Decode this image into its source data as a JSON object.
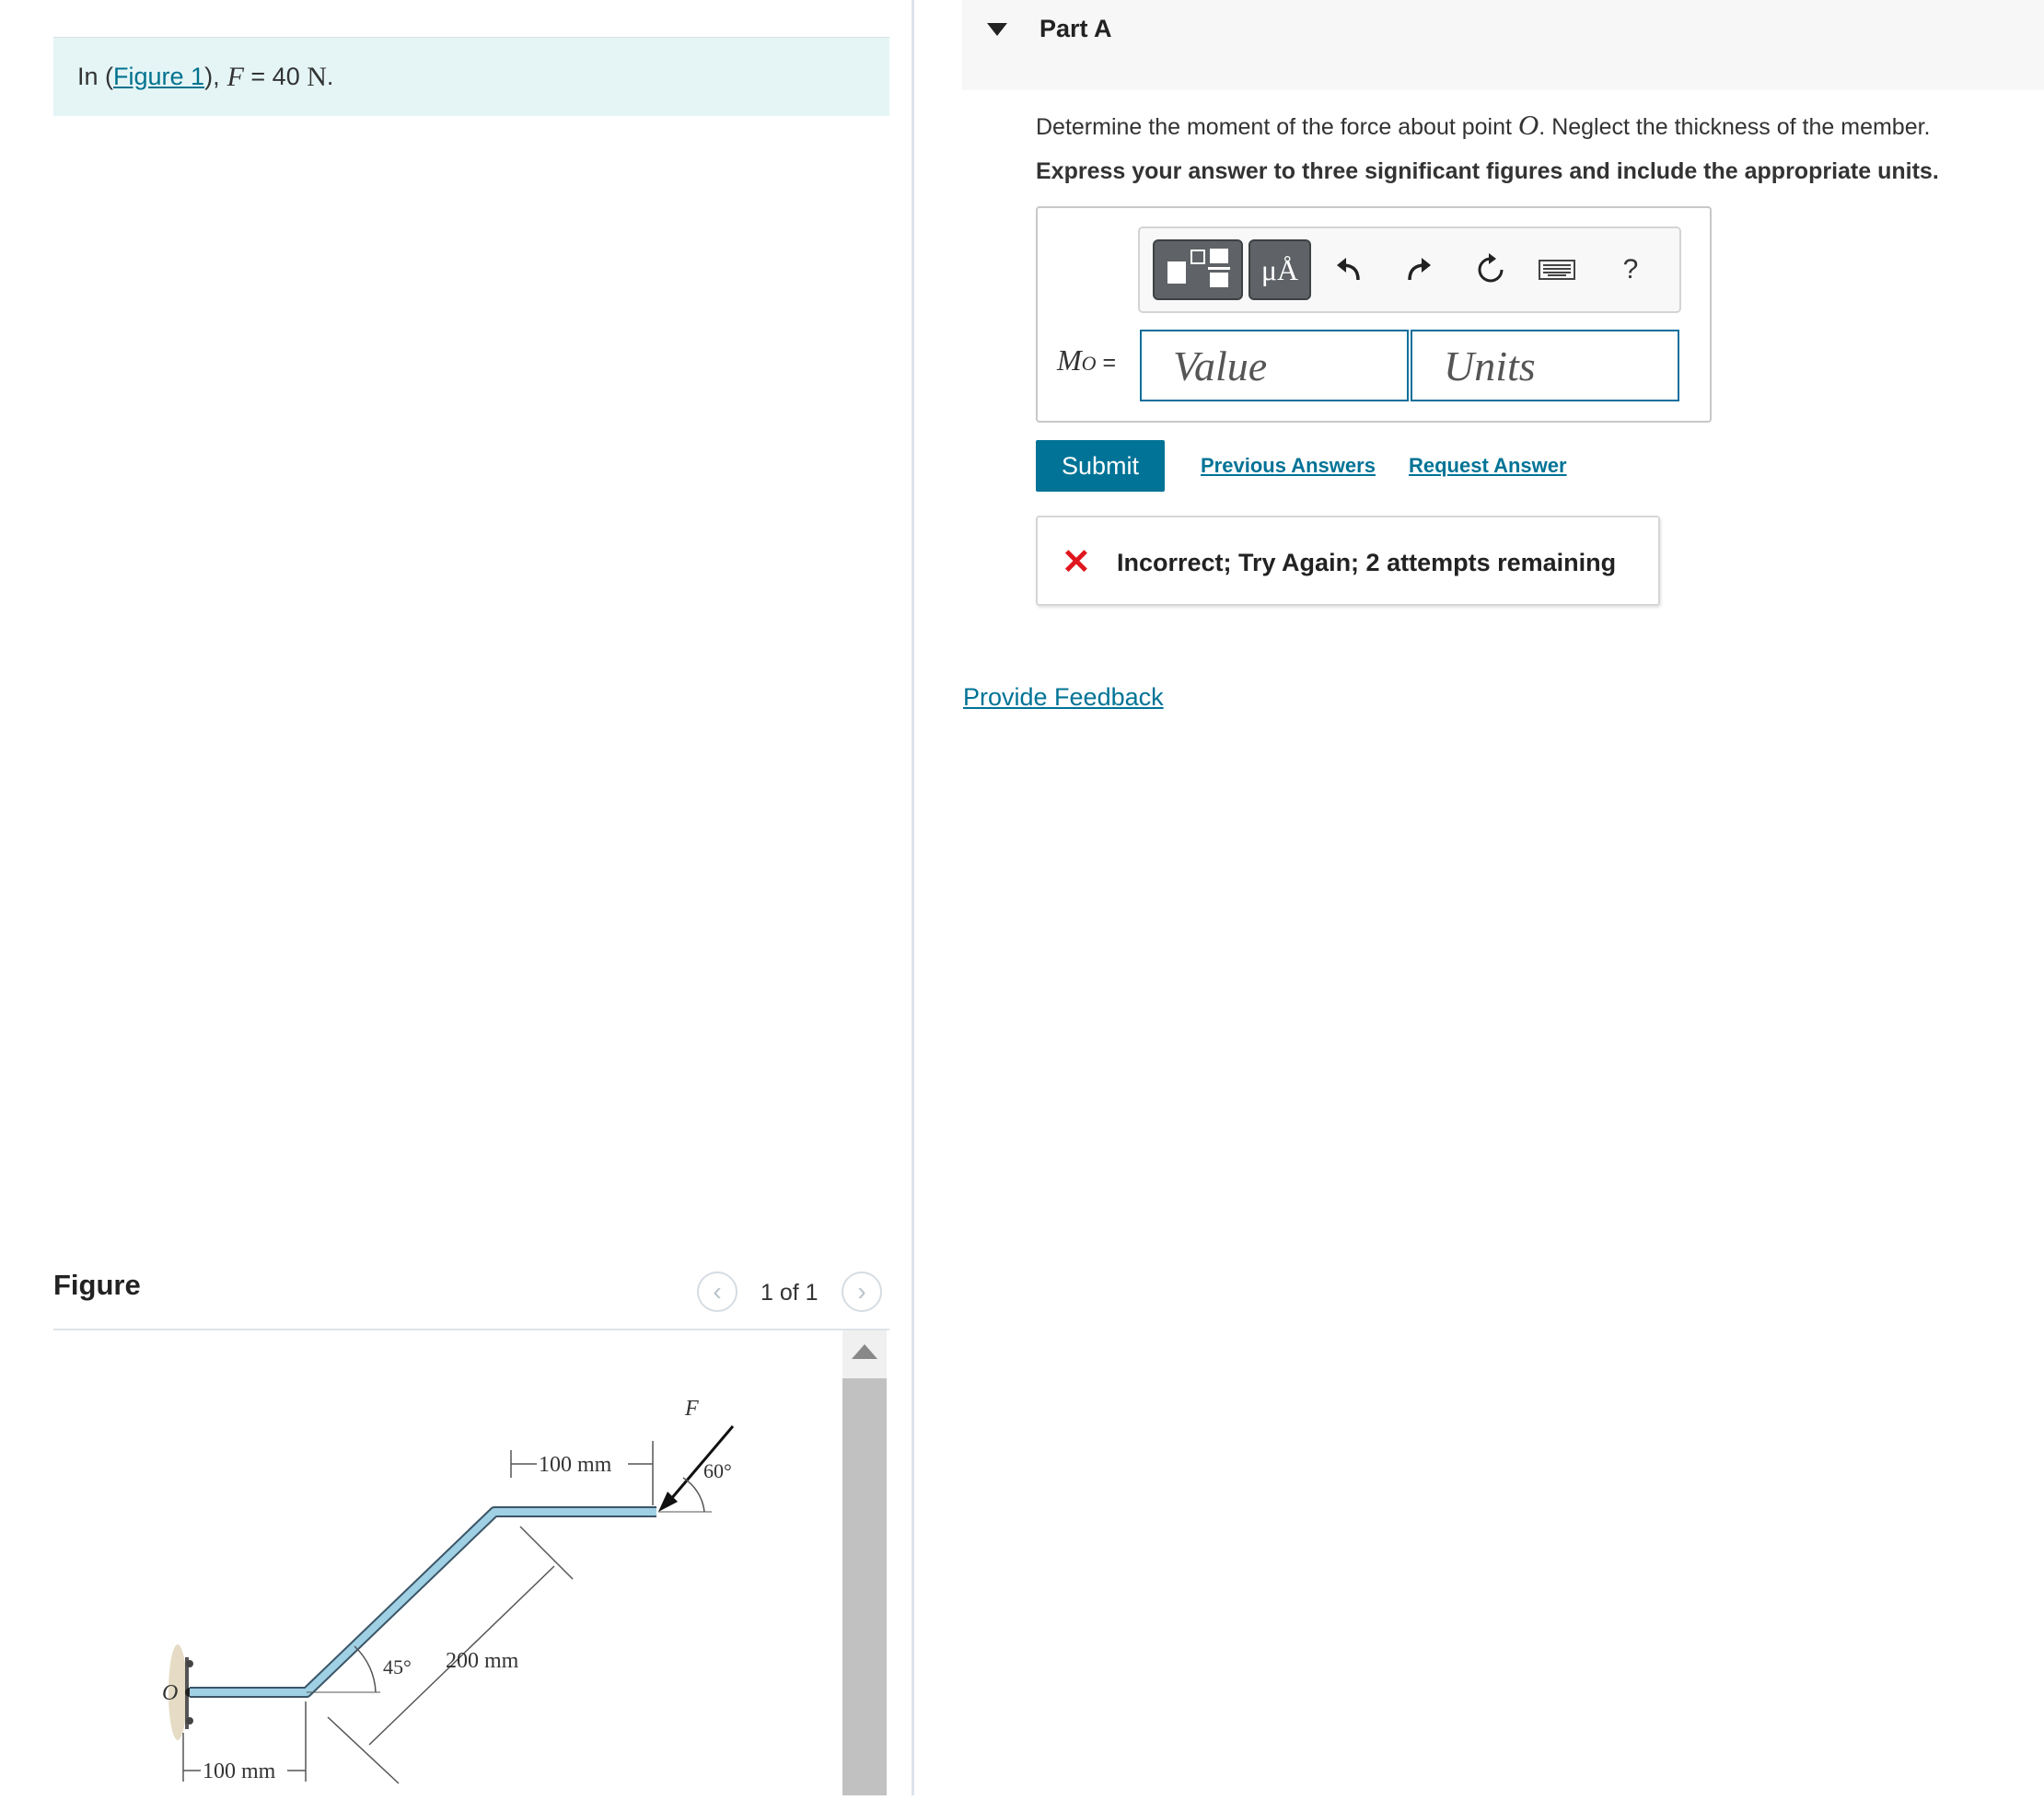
{
  "problem": {
    "prefix": "In (",
    "figure_link": "Figure 1",
    "suffix": "),",
    "variable": "F",
    "equals": " = 40 ",
    "unit": "N",
    "period": "."
  },
  "figure": {
    "title": "Figure",
    "pager": "1 of 1",
    "labels": {
      "force": "F",
      "angle_60": "60°",
      "angle_45": "45°",
      "dim_top": "100 mm",
      "dim_diag": "200 mm",
      "dim_bottom": "100 mm",
      "point_o": "O"
    }
  },
  "part": {
    "label": "Part A",
    "question_prefix": "Determine the moment of the force about point ",
    "question_var": "O",
    "question_suffix": ". Neglect the thickness of the member.",
    "instruction": "Express your answer to three significant figures and include the appropriate units."
  },
  "answer": {
    "label_var": "M",
    "label_sub": "O",
    "label_eq": " =",
    "value_placeholder": "Value",
    "units_placeholder": "Units",
    "toolbar": {
      "mu_label": "μÅ",
      "help_label": "?"
    }
  },
  "actions": {
    "submit": "Submit",
    "previous_answers": "Previous Answers",
    "request_answer": "Request Answer"
  },
  "feedback": {
    "message": "Incorrect; Try Again; 2 attempts remaining",
    "status_color": "#e0161e"
  },
  "provide_feedback": "Provide Feedback",
  "colors": {
    "accent": "#007396",
    "problem_bg": "#e5f5f6",
    "member": "#9fd0e4"
  }
}
